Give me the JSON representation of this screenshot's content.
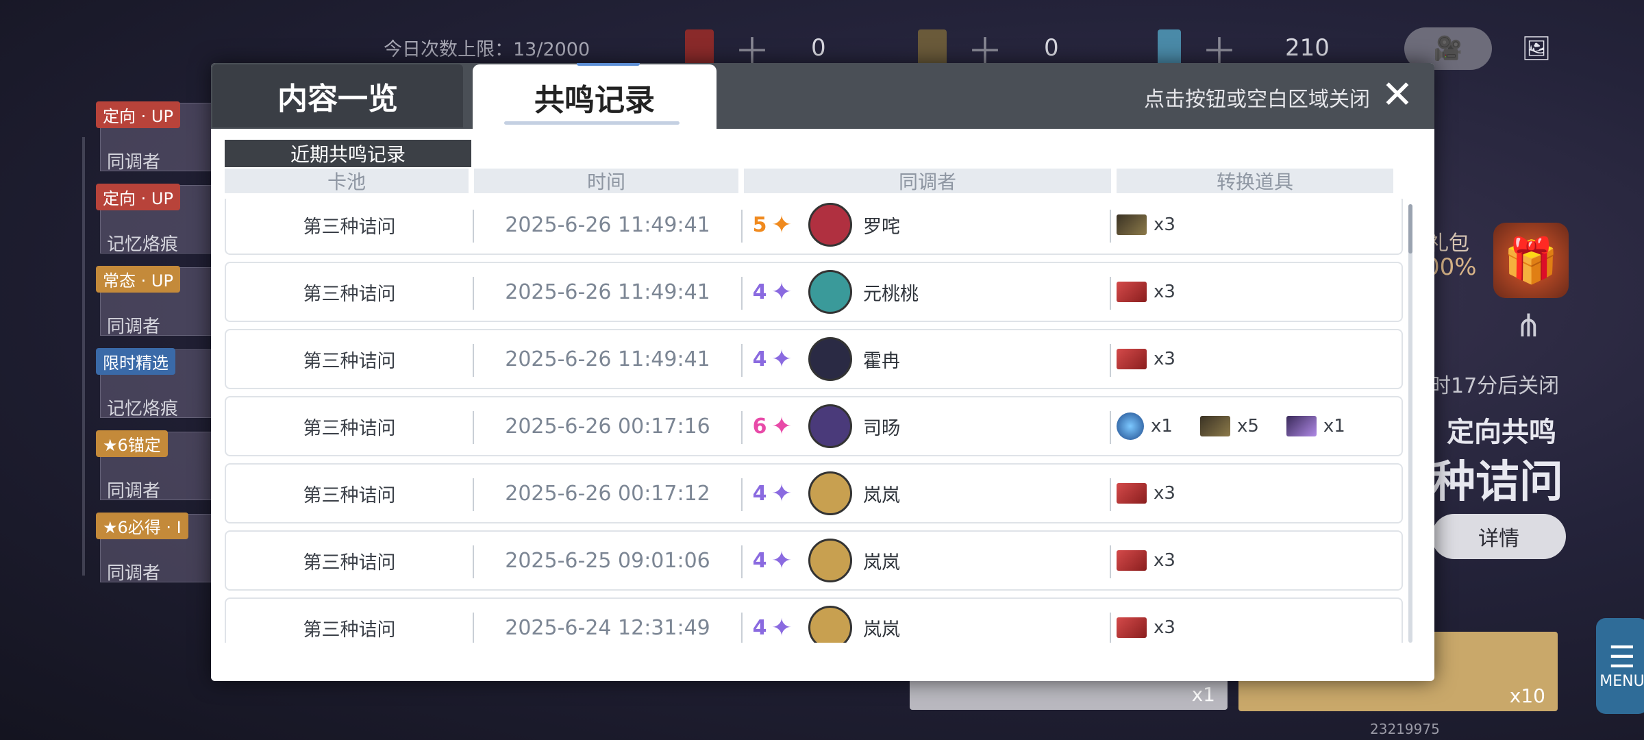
{
  "hud": {
    "daily_limit": "今日次数上限：13/2000",
    "res1": "0",
    "res2": "0",
    "res3": "210",
    "uid": "23219975"
  },
  "sidebar": {
    "items": [
      {
        "tag": "定向 · UP",
        "name": "同调者",
        "tag_color": "#b8433a"
      },
      {
        "tag": "定向 · UP",
        "name": "记忆烙痕",
        "tag_color": "#b8433a"
      },
      {
        "tag": "常态 · UP",
        "name": "同调者",
        "tag_color": "#c48a3a"
      },
      {
        "tag": "限时精选",
        "name": "记忆烙痕",
        "tag_color": "#3a6aa8"
      },
      {
        "tag": "★6锚定",
        "name": "同调者",
        "tag_color": "#c48a3a"
      },
      {
        "tag": "★6必得 · I",
        "name": "同调者",
        "tag_color": "#c48a3a"
      }
    ]
  },
  "right": {
    "gift_label": "礼包",
    "gift_pct": "00%",
    "close_hint": "时17分后关闭",
    "dir_title": "定向共鸣",
    "big_title": "种诘问",
    "detail_button": "详情",
    "pull1_count": "x1",
    "pull10_count": "x10",
    "menu_label": "MENU"
  },
  "modal": {
    "tab_content": "内容一览",
    "tab_record": "共鸣记录",
    "head_hint": "点击按钮或空白区域关闭",
    "close_symbol": "✕",
    "section_label": "近期共鸣记录",
    "columns": [
      "卡池",
      "时间",
      "同调者",
      "转换道具"
    ],
    "rows": [
      {
        "pool": "第三种诘问",
        "time": "2025-6-26   11:49:41",
        "star": "5",
        "star_color": "#f08a1e",
        "name": "罗咤",
        "items": [
          {
            "icon": "gold-card-icon",
            "qty": "x3"
          }
        ]
      },
      {
        "pool": "第三种诘问",
        "time": "2025-6-26   11:49:41",
        "star": "4",
        "star_color": "#8a6ae0",
        "name": "元桃桃",
        "items": [
          {
            "icon": "red-card-icon",
            "qty": "x3"
          }
        ]
      },
      {
        "pool": "第三种诘问",
        "time": "2025-6-26   11:49:41",
        "star": "4",
        "star_color": "#8a6ae0",
        "name": "霍冉",
        "items": [
          {
            "icon": "red-card-icon",
            "qty": "x3"
          }
        ]
      },
      {
        "pool": "第三种诘问",
        "time": "2025-6-26   00:17:16",
        "star": "6",
        "star_color": "#e84aa8",
        "name": "司旸",
        "items": [
          {
            "icon": "blue-orb-icon",
            "qty": "x1"
          },
          {
            "icon": "gold-card-icon",
            "qty": "x5"
          },
          {
            "icon": "purple-card-icon",
            "qty": "x1"
          }
        ]
      },
      {
        "pool": "第三种诘问",
        "time": "2025-6-26   00:17:12",
        "star": "4",
        "star_color": "#8a6ae0",
        "name": "岚岚",
        "items": [
          {
            "icon": "red-card-icon",
            "qty": "x3"
          }
        ]
      },
      {
        "pool": "第三种诘问",
        "time": "2025-6-25   09:01:06",
        "star": "4",
        "star_color": "#8a6ae0",
        "name": "岚岚",
        "items": [
          {
            "icon": "red-card-icon",
            "qty": "x3"
          }
        ]
      },
      {
        "pool": "第三种诘问",
        "time": "2025-6-24   12:31:49",
        "star": "4",
        "star_color": "#8a6ae0",
        "name": "岚岚",
        "items": [
          {
            "icon": "red-card-icon",
            "qty": "x3"
          }
        ]
      }
    ]
  }
}
